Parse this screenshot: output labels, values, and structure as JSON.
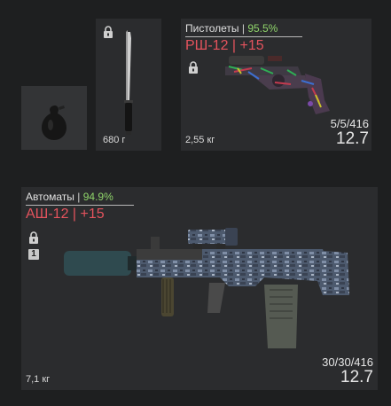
{
  "grenade_slot": {
    "icon": "grenade-icon"
  },
  "melee_slot": {
    "icon": "knife-icon",
    "locked": true,
    "weight": "680 г"
  },
  "pistol_slot": {
    "category": "Пистолеты",
    "separator": "|",
    "durability": "95.5%",
    "name": "РШ-12 | +15",
    "locked": true,
    "weight": "2,55 кг",
    "ammo": "5/5/416",
    "caliber": "12.7",
    "icon": "revolver-icon"
  },
  "rifle_slot": {
    "category": "Автоматы",
    "separator": "|",
    "durability": "94.9%",
    "name": "АШ-12 | +15",
    "locked": true,
    "badge": "1",
    "weight": "7,1 кг",
    "ammo": "30/30/416",
    "caliber": "12.7",
    "icon": "assault-rifle-icon"
  },
  "colors": {
    "durability_green": "#8fd46a",
    "name_red": "#e4535d",
    "slot_bg": "#2b2c2e",
    "page_bg": "#1e1f20"
  }
}
